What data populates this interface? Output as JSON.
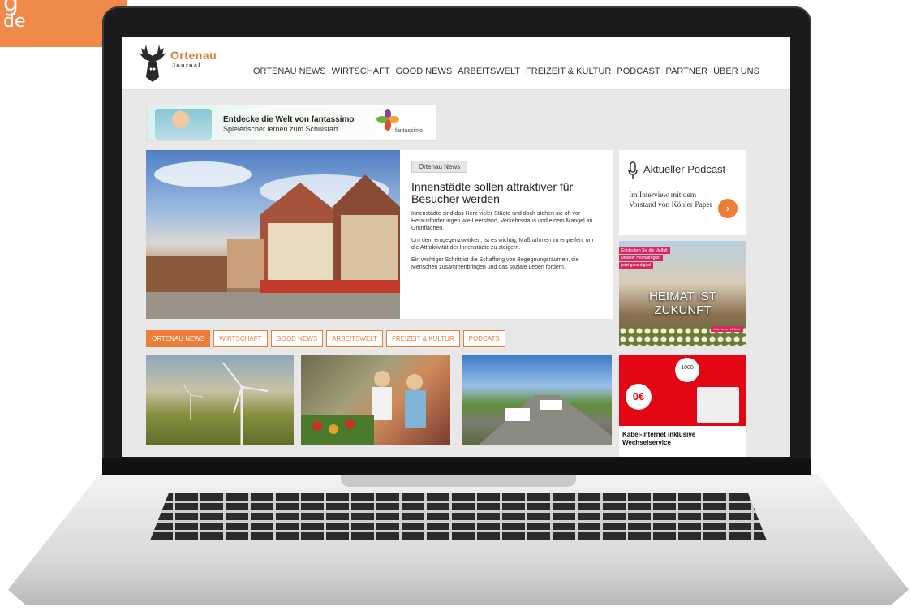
{
  "corner": {
    "big": "g",
    "small": "de"
  },
  "site": {
    "logo_name": "Ortenau",
    "logo_sub": "Journal",
    "nav": [
      "ORTENAU NEWS",
      "WIRTSCHAFT",
      "GOOD NEWS",
      "ARBEITSWELT",
      "FREIZEIT & KULTUR",
      "PODCAST",
      "PARTNER",
      "ÜBER UNS"
    ]
  },
  "banner": {
    "headline": "Entdecke die Welt von fantassimo",
    "subline": "Spielerischer lernen zum Schulstart.",
    "brand": "fantassimo"
  },
  "hero": {
    "tag": "Ortenau News",
    "title": "Innenstädte sollen attraktiver für Besucher werden",
    "paragraphs": [
      "Innenstädte sind das Herz vieler Städte und doch stehen sie oft vor Herausforderungen wie Leerstand, Verkehrsstaus und einem Mangel an Grünflächen.",
      "Um dem entgegenzuwirken, ist es wichtig, Maßnahmen zu ergreifen, um die Attraktivität der Innenstädte zu steigern.",
      "Ein wichtiger Schritt ist die Schaffung von Begegnungsräumen, die Menschen zusammenbringen und das soziale Leben fördern."
    ]
  },
  "podcast": {
    "title": "Aktueller Podcast",
    "text": "Im Interview mit dem Vorstand von Köhler Paper",
    "go_symbol": "›"
  },
  "heimat": {
    "labels": [
      "Entdecken Sie die Vielfalt",
      "unserer Heimatregion",
      "jetzt ganz digital"
    ],
    "headline_1": "HEIMAT IST",
    "headline_2": "ZUKUNFT",
    "button": "Jetzt lesen klicken"
  },
  "tabs": [
    "ORTENAU NEWS",
    "WIRTSCHAFT",
    "GOOD NEWS",
    "ARBEITSWELT",
    "FREIZEIT & KULTUR",
    "PODCATS"
  ],
  "vodafone": {
    "circle": "1000",
    "price": "0€",
    "text_1": "Kabel-Internet inklusive",
    "text_2": "Wechselservice"
  },
  "colors": {
    "accent": "#ef7d3a",
    "logo": "#e0762f",
    "vodafone_red": "#e30613",
    "heimat_pink": "#d7275f"
  }
}
